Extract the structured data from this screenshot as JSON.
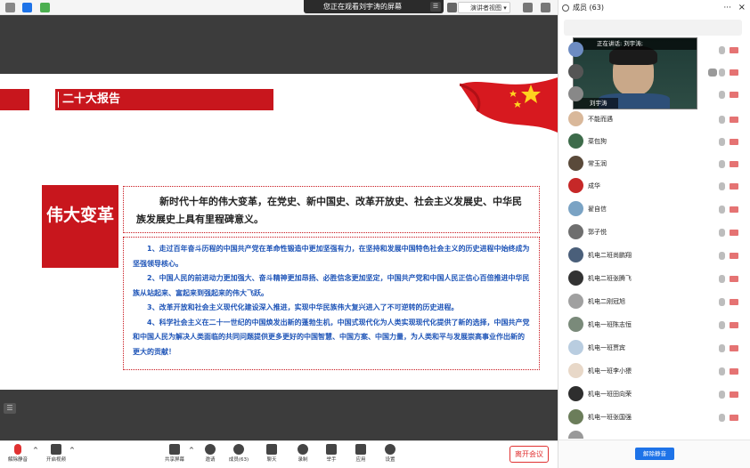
{
  "banner": {
    "text": "您正在观看刘宇涛的屏幕"
  },
  "topbar": {
    "presenter_view": "演讲者视图"
  },
  "slide": {
    "section_title": "二十大报告",
    "side_label": "伟大变革",
    "headline": "新时代十年的伟大变革，在党史、新中国史、改革开放史、社会主义发展史、中华民族发展史上具有里程碑意义。",
    "points": [
      "1、走过百年奋斗历程的中国共产党在革命性锻造中更加坚强有力，在坚持和发展中国特色社会主义的历史进程中始终成为坚强领导核心。",
      "2、中国人民的前进动力更加强大、奋斗精神更加昂扬、必胜信念更加坚定，中国共产党和中国人民正信心百倍推进中华民族从站起来、富起来到强起来的伟大飞跃。",
      "3、改革开放和社会主义现代化建设深入推进，实现中华民族伟大复兴进入了不可逆转的历史进程。",
      "4、科学社会主义在二十一世纪的中国焕发出新的蓬勃生机，中国式现代化为人类实现现代化提供了新的选择，中国共产党和中国人民为解决人类面临的共同问题提供更多更好的中国智慧、中国方案、中国力量，为人类和平与发展崇高事业作出新的更大的贡献！"
    ]
  },
  "toolbar": {
    "mute": "解除静音",
    "video": "开启视频",
    "share": "共享屏幕",
    "invite": "邀请",
    "members": "成员(63)",
    "chat": "聊天",
    "record": "录制",
    "raise_hand": "举手",
    "apps": "应用",
    "settings": "设置",
    "leave": "离开会议"
  },
  "panel": {
    "title": "成员 (63)",
    "speaking": "正在讲话: 刘宇涛;",
    "video_name": "刘宇涛",
    "unmute_all": "解除静音",
    "members": [
      "不能而遇",
      "菜包狗",
      "常玉润",
      "成华",
      "翟自信",
      "郭子悦",
      "机电二班尚鹏翔",
      "机电二班张腾飞",
      "机电二刚冠旭",
      "机电一班陈志恒",
      "机电一班贾宾",
      "机电一班李小猥",
      "机电一班田向荣",
      "机电一班张国强"
    ]
  },
  "colors": {
    "accent_red": "#c8161d",
    "text_blue": "#1f55b8",
    "primary_blue": "#1e73e8"
  }
}
